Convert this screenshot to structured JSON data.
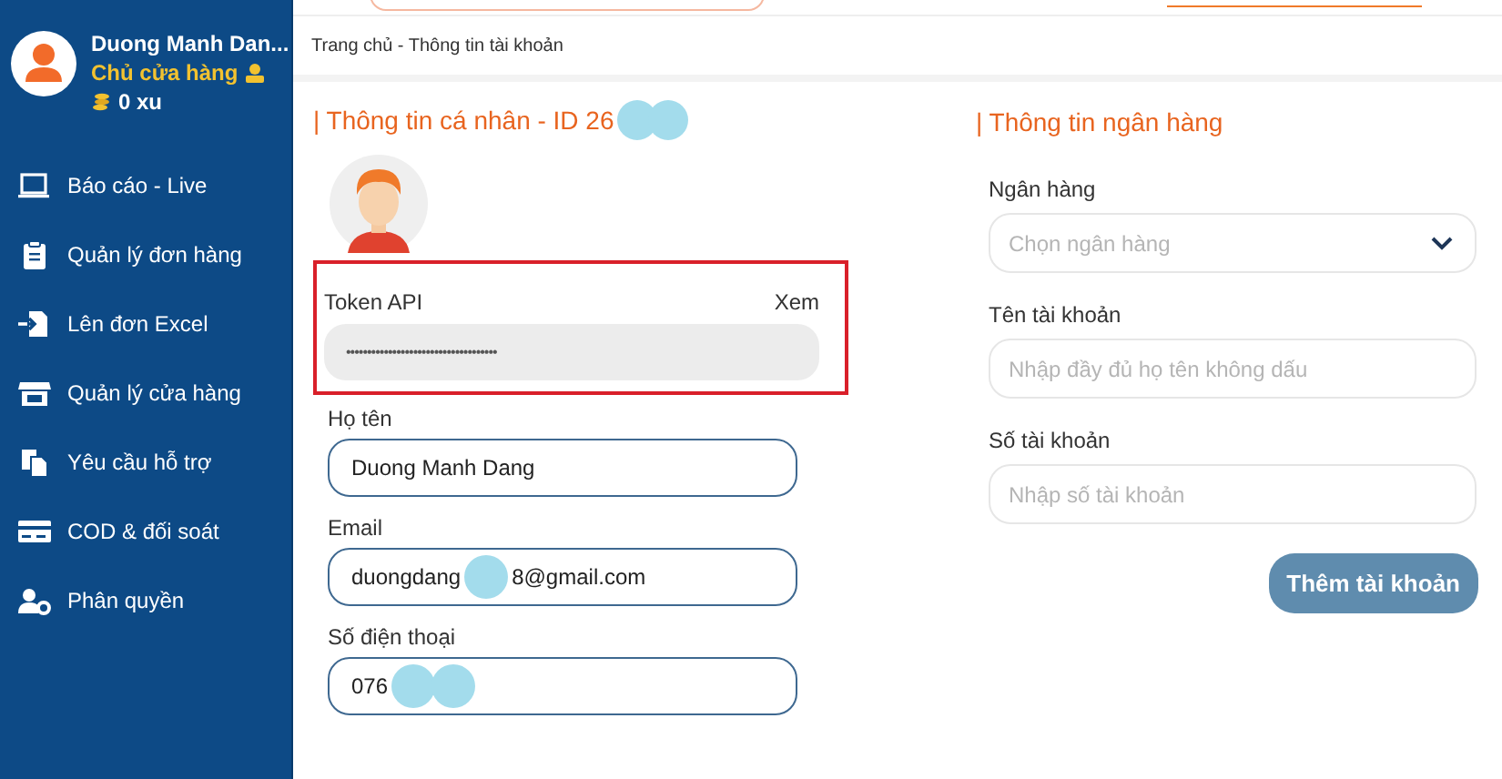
{
  "profile": {
    "name": "Duong Manh Dan...",
    "role": "Chủ cửa hàng",
    "coins": "0 xu"
  },
  "menu": [
    {
      "kind": "monitor",
      "label": "Báo cáo - Live"
    },
    {
      "kind": "clipboard",
      "label": "Quản lý đơn hàng"
    },
    {
      "kind": "import",
      "label": "Lên đơn Excel"
    },
    {
      "kind": "store",
      "label": "Quản lý cửa hàng"
    },
    {
      "kind": "copy",
      "label": "Yêu cầu hỗ trợ"
    },
    {
      "kind": "card",
      "label": "COD & đối soát"
    },
    {
      "kind": "usergear",
      "label": "Phân quyền"
    }
  ],
  "breadcrumb": "Trang chủ - Thông tin tài khoản",
  "personal": {
    "title": "| Thông tin cá nhân - ID 26",
    "token_label": "Token API",
    "token_toggle": "Xem",
    "token_value": "••••••••••••••••••••••••••••••••••••",
    "fields": [
      {
        "label": "Họ tên",
        "value": "Duong Manh Dang",
        "redacted": false
      },
      {
        "label": "Email",
        "value": "duongdang",
        "value_after": "8@gmail.com",
        "redacted": true
      },
      {
        "label": "Số điện thoại",
        "value": "076",
        "redacted": true
      }
    ]
  },
  "bank": {
    "title": "| Thông tin ngân hàng",
    "fields": [
      {
        "kind": "select",
        "label": "Ngân hàng",
        "placeholder": "Chọn ngân hàng"
      },
      {
        "kind": "text",
        "label": "Tên tài khoản",
        "placeholder": "Nhập đầy đủ họ tên không dấu"
      },
      {
        "kind": "text",
        "label": "Số tài khoản",
        "placeholder": "Nhập số tài khoản"
      }
    ],
    "button": "Thêm tài khoản"
  }
}
